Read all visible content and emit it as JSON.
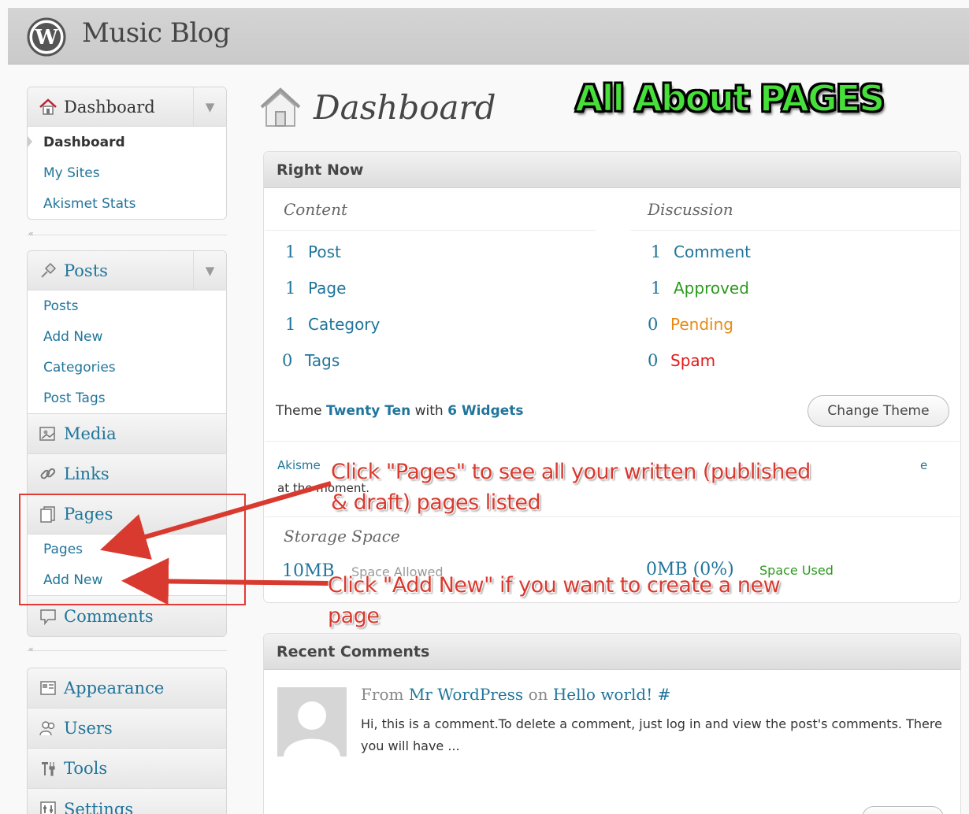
{
  "header": {
    "site_title": "Music Blog"
  },
  "sidebar": {
    "dashboard_menu": {
      "label": "Dashboard",
      "items": [
        {
          "label": "Dashboard"
        },
        {
          "label": "My Sites"
        },
        {
          "label": "Akismet Stats"
        }
      ]
    },
    "posts_menu": {
      "label": "Posts",
      "items": [
        {
          "label": "Posts"
        },
        {
          "label": "Add New"
        },
        {
          "label": "Categories"
        },
        {
          "label": "Post Tags"
        }
      ]
    },
    "media_label": "Media",
    "links_label": "Links",
    "pages_menu": {
      "label": "Pages",
      "items": [
        {
          "label": "Pages"
        },
        {
          "label": "Add New"
        }
      ]
    },
    "comments_label": "Comments",
    "appearance_label": "Appearance",
    "users_label": "Users",
    "tools_label": "Tools",
    "settings_label": "Settings",
    "separator_mark": "«"
  },
  "main": {
    "page_title": "Dashboard",
    "promo_title": "All About PAGES",
    "right_now": {
      "title": "Right Now",
      "content_title": "Content",
      "discussion_title": "Discussion",
      "content": [
        {
          "num": "1",
          "label": "Post"
        },
        {
          "num": "1",
          "label": "Page"
        },
        {
          "num": "1",
          "label": "Category"
        },
        {
          "num": "0",
          "label": "Tags"
        }
      ],
      "discussion": [
        {
          "num": "1",
          "label": "Comment"
        },
        {
          "num": "1",
          "label": "Approved"
        },
        {
          "num": "0",
          "label": "Pending"
        },
        {
          "num": "0",
          "label": "Spam"
        }
      ],
      "theme_prefix": "Theme",
      "theme_name": "Twenty Ten",
      "theme_with": "with",
      "widgets": "6 Widgets",
      "change_theme_label": "Change Theme",
      "akismet_start": "Akisme",
      "akismet_line2": "at the moment.",
      "akismet_tail": "e",
      "storage_title": "Storage Space",
      "space_allowed_num": "10MB",
      "space_allowed_label": "Space Allowed",
      "space_used_num": "0MB (0%)",
      "space_used_label": "Space Used"
    },
    "recent_comments": {
      "title": "Recent Comments",
      "from": "From",
      "author": "Mr WordPress",
      "on": "on",
      "post": "Hello world!",
      "hash": "#",
      "text": "Hi, this is a comment.To delete a comment, just log in and view the post's comments. There you will have ..."
    }
  },
  "annotations": {
    "callout_pages_line1": "Click \"Pages\" to see all your written (published",
    "callout_pages_line2": "& draft) pages listed",
    "callout_addnew_line1": "Click \"Add New\" if you want to create a new",
    "callout_addnew_line2": "page"
  },
  "colors": {
    "link": "#21759b",
    "approved": "#2b9a1d",
    "pending": "#e68b12",
    "spam": "#e21a1a",
    "annotation": "#d93a2f",
    "promo": "#47e03a"
  },
  "icons": {
    "wordpress": "wordpress-logo",
    "dashboard": "home-icon",
    "posts": "pushpin-icon",
    "media": "media-icon",
    "links": "link-icon",
    "pages": "pages-icon",
    "comments": "comment-bubble-icon",
    "appearance": "appearance-icon",
    "users": "users-icon",
    "tools": "tools-icon",
    "settings": "settings-icon"
  }
}
